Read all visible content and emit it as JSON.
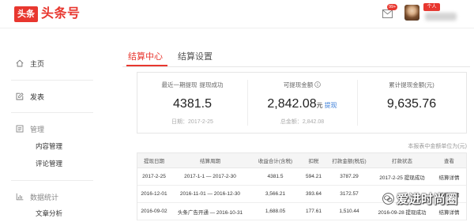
{
  "header": {
    "logo_badge": "头条",
    "logo_text": "头条号",
    "message_badge": "99+",
    "account_type": "个人",
    "icons": {
      "messages": "mail-icon"
    }
  },
  "sidebar": {
    "items": [
      {
        "label": "主页",
        "icon": "home-icon"
      },
      {
        "label": "发表",
        "icon": "edit-icon"
      },
      {
        "label": "管理",
        "icon": "manage-icon",
        "children": [
          "内容管理",
          "评论管理"
        ]
      },
      {
        "label": "数据统计",
        "icon": "chart-icon",
        "children": [
          "文章分析"
        ]
      }
    ]
  },
  "tabs": [
    {
      "label": "结算中心",
      "active": true
    },
    {
      "label": "结算设置",
      "active": false
    }
  ],
  "summary": {
    "latest_withdrawal": {
      "label": "最近一期提现",
      "status": "提现成功",
      "value": "4381.5",
      "date": "日期：2017-2-25"
    },
    "available": {
      "label": "可提现金额",
      "icon": "info-icon",
      "value": "2,842.08",
      "unit": "元",
      "action": "提现",
      "total": "总金额：2,842.08"
    },
    "cumulative": {
      "label": "累计提现金额(元)",
      "value": "9,635.76"
    }
  },
  "unit_note": "本报表中金额单位为(元)",
  "table": {
    "columns": [
      "提现日期",
      "结算周期",
      "收益合计(含税)",
      "扣税",
      "打款金额(税后)",
      "打款状态",
      "查看"
    ],
    "rows": [
      {
        "date": "2017-2-25",
        "period": "2017-1-1 — 2017-2-30",
        "income": "4381.5",
        "tax": "594.21",
        "payout": "3787.29",
        "status": "2017-2-25 提现成功",
        "action": "结算详情"
      },
      {
        "date": "2016-12-01",
        "period": "2016-11-01 — 2016-12-30",
        "income": "3,566.21",
        "tax": "393.64",
        "payout": "3172.57",
        "status": "",
        "action": "结算详情"
      },
      {
        "date": "2016-09-02",
        "period": "头条广告开通 — 2016-10-31",
        "income": "1,688.05",
        "tax": "177.61",
        "payout": "1,510.44",
        "status": "2016-09-28 提现成功",
        "action": "结算详情"
      }
    ]
  },
  "watermark": {
    "text": "爱进时尚圈",
    "icon": "wechat-icon"
  },
  "colors": {
    "accent": "#e8372f",
    "link": "#3d7fd8",
    "text": "#333333",
    "muted": "#999999",
    "border": "#e6e6e6",
    "table_header_bg": "#f5f5f5"
  }
}
